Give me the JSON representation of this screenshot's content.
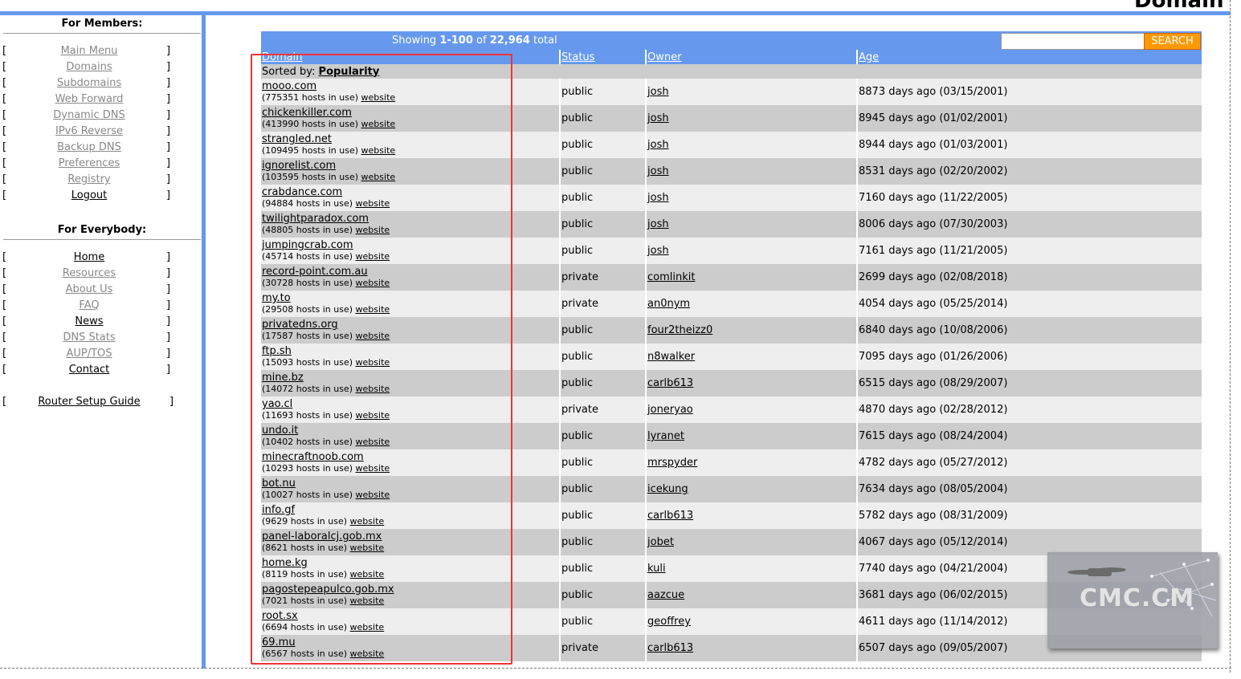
{
  "page_title": "Domain",
  "sidebar": {
    "members_heading": "For Members:",
    "members_items": [
      {
        "label": "Main Menu",
        "dim": true
      },
      {
        "label": "Domains",
        "dim": true
      },
      {
        "label": "Subdomains",
        "dim": true
      },
      {
        "label": "Web Forward",
        "dim": true
      },
      {
        "label": "Dynamic DNS",
        "dim": true
      },
      {
        "label": "IPv6 Reverse",
        "dim": true
      },
      {
        "label": "Backup DNS",
        "dim": true
      },
      {
        "label": "Preferences",
        "dim": true
      },
      {
        "label": "Registry",
        "dim": true
      },
      {
        "label": "Logout",
        "dim": false
      }
    ],
    "everybody_heading": "For Everybody:",
    "everybody_items": [
      {
        "label": "Home",
        "dim": false
      },
      {
        "label": "Resources",
        "dim": true
      },
      {
        "label": "About Us",
        "dim": true
      },
      {
        "label": "FAQ",
        "dim": true
      },
      {
        "label": "News",
        "dim": false
      },
      {
        "label": "DNS Stats",
        "dim": true
      },
      {
        "label": "AUP/TOS",
        "dim": true
      },
      {
        "label": "Contact",
        "dim": false
      }
    ],
    "router_guide": "Router Setup Guide",
    "bracket_open": "[",
    "bracket_close": "]"
  },
  "results": {
    "showing_prefix": "Showing ",
    "range": "1-100",
    "of": " of ",
    "total": "22,964",
    "total_suffix": " total",
    "search_placeholder": "",
    "search_button": "SEARCH"
  },
  "table": {
    "headers": [
      "Domain",
      "Status",
      "Owner",
      "Age"
    ],
    "sorted_by_label": "Sorted by: ",
    "sorted_by_value": "Popularity",
    "website_label": "website",
    "rows": [
      {
        "domain": "mooo.com",
        "hosts": "(775351 hosts in use) ",
        "status": "public",
        "owner": "josh",
        "age": "8873 days ago (03/15/2001)"
      },
      {
        "domain": "chickenkiller.com",
        "hosts": "(413990 hosts in use) ",
        "status": "public",
        "owner": "josh",
        "age": "8945 days ago (01/02/2001)"
      },
      {
        "domain": "strangled.net",
        "hosts": "(109495 hosts in use) ",
        "status": "public",
        "owner": "josh",
        "age": "8944 days ago (01/03/2001)"
      },
      {
        "domain": "ignorelist.com",
        "hosts": "(103595 hosts in use) ",
        "status": "public",
        "owner": "josh",
        "age": "8531 days ago (02/20/2002)"
      },
      {
        "domain": "crabdance.com",
        "hosts": "(94884 hosts in use) ",
        "status": "public",
        "owner": "josh",
        "age": "7160 days ago (11/22/2005)"
      },
      {
        "domain": "twilightparadox.com",
        "hosts": "(48805 hosts in use) ",
        "status": "public",
        "owner": "josh",
        "age": "8006 days ago (07/30/2003)"
      },
      {
        "domain": "jumpingcrab.com",
        "hosts": "(45714 hosts in use) ",
        "status": "public",
        "owner": "josh",
        "age": "7161 days ago (11/21/2005)"
      },
      {
        "domain": "record-point.com.au",
        "hosts": "(30728 hosts in use) ",
        "status": "private",
        "owner": "comlinkit",
        "age": "2699 days ago (02/08/2018)"
      },
      {
        "domain": "my.to",
        "hosts": "(29508 hosts in use) ",
        "status": "private",
        "owner": "an0nym",
        "age": "4054 days ago (05/25/2014)"
      },
      {
        "domain": "privatedns.org",
        "hosts": "(17587 hosts in use) ",
        "status": "public",
        "owner": "four2theizz0",
        "age": "6840 days ago (10/08/2006)"
      },
      {
        "domain": "ftp.sh",
        "hosts": "(15093 hosts in use) ",
        "status": "public",
        "owner": "n8walker",
        "age": "7095 days ago (01/26/2006)"
      },
      {
        "domain": "mine.bz",
        "hosts": "(14072 hosts in use) ",
        "status": "public",
        "owner": "carlb613",
        "age": "6515 days ago (08/29/2007)"
      },
      {
        "domain": "yao.cl",
        "hosts": "(11693 hosts in use) ",
        "status": "private",
        "owner": "joneryao",
        "age": "4870 days ago (02/28/2012)"
      },
      {
        "domain": "undo.it",
        "hosts": "(10402 hosts in use) ",
        "status": "public",
        "owner": "lyranet",
        "age": "7615 days ago (08/24/2004)"
      },
      {
        "domain": "minecraftnoob.com",
        "hosts": "(10293 hosts in use) ",
        "status": "public",
        "owner": "mrspyder",
        "age": "4782 days ago (05/27/2012)"
      },
      {
        "domain": "bot.nu",
        "hosts": "(10027 hosts in use) ",
        "status": "public",
        "owner": "icekung",
        "age": "7634 days ago (08/05/2004)"
      },
      {
        "domain": "info.gf",
        "hosts": "(9629 hosts in use) ",
        "status": "public",
        "owner": "carlb613",
        "age": "5782 days ago (08/31/2009)"
      },
      {
        "domain": "panel-laboralcj.gob.mx",
        "hosts": "(8621 hosts in use) ",
        "status": "public",
        "owner": "jobet",
        "age": "4067 days ago (05/12/2014)"
      },
      {
        "domain": "home.kg",
        "hosts": "(8119 hosts in use) ",
        "status": "public",
        "owner": "kuli",
        "age": "7740 days ago (04/21/2004)"
      },
      {
        "domain": "pagostepeapulco.gob.mx",
        "hosts": "(7021 hosts in use) ",
        "status": "public",
        "owner": "aazcue",
        "age": "3681 days ago (06/02/2015)"
      },
      {
        "domain": "root.sx",
        "hosts": "(6694 hosts in use) ",
        "status": "public",
        "owner": "geoffrey",
        "age": "4611 days ago (11/14/2012)"
      },
      {
        "domain": "69.mu",
        "hosts": "(6567 hosts in use) ",
        "status": "private",
        "owner": "carlb613",
        "age": "6507 days ago (09/05/2007)"
      }
    ]
  },
  "watermark": {
    "text": "CMC.CM"
  },
  "colors": {
    "header_blue": "#6699ee",
    "search_orange": "#ff9900",
    "highlight_red": "#ee3333"
  }
}
